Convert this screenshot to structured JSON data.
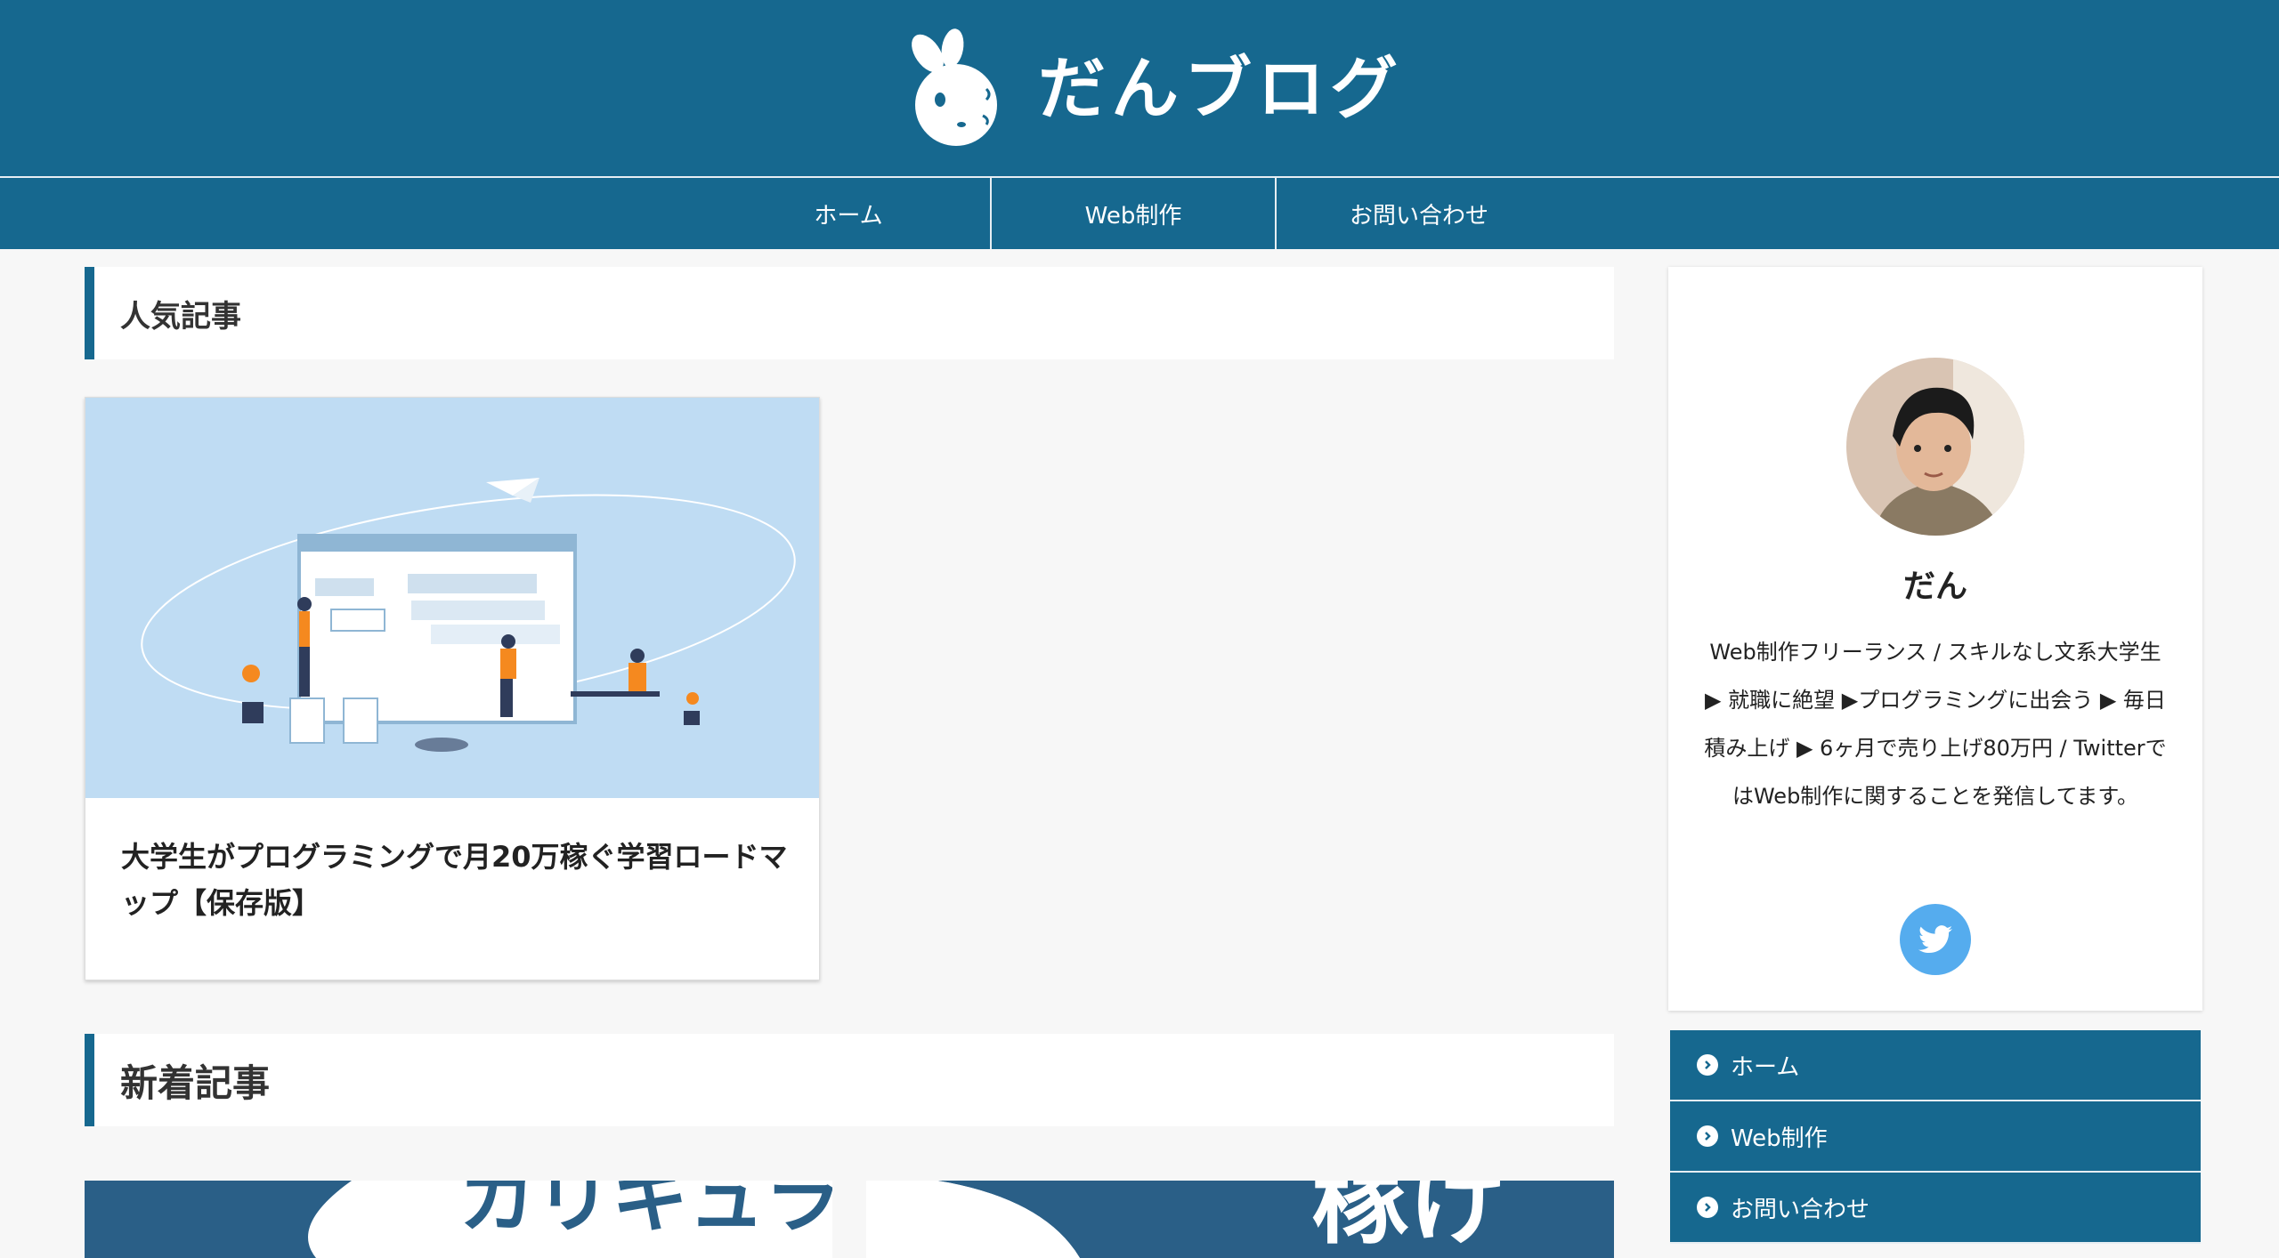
{
  "header": {
    "site_title": "だんブログ",
    "logo_icon": "rabbit-logo-icon",
    "brand_color": "#16688f"
  },
  "nav": {
    "items": [
      {
        "label": "ホーム"
      },
      {
        "label": "Web制作"
      },
      {
        "label": "お問い合わせ"
      }
    ]
  },
  "main": {
    "popular_heading": "人気記事",
    "popular_articles": [
      {
        "title": "大学生がプログラミングで月20万稼ぐ学習ロードマップ【保存版】"
      }
    ],
    "new_heading": "新着記事",
    "new_articles": [
      {
        "thumb_text": "カリキュラ"
      },
      {
        "thumb_text": "稼げ"
      }
    ]
  },
  "sidebar": {
    "profile": {
      "name": "だん",
      "bio": "Web制作フリーランス / スキルなし文系大学生 ▶ 就職に絶望 ▶プログラミングに出会う ▶ 毎日積み上げ ▶ 6ヶ月で売り上げ80万円 / TwitterではWeb制作に関することを発信してます。",
      "social_icon": "twitter-icon",
      "social_color": "#55acee"
    },
    "menu": [
      {
        "label": "ホーム"
      },
      {
        "label": "Web制作"
      },
      {
        "label": "お問い合わせ"
      }
    ]
  }
}
